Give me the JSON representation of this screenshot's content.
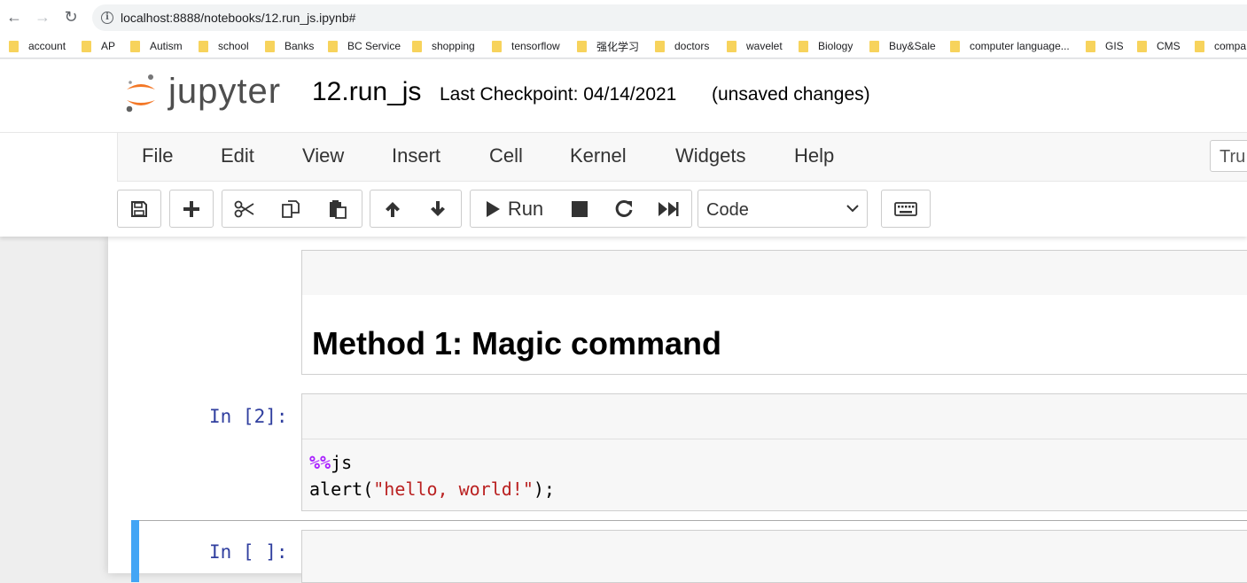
{
  "browser": {
    "url": "localhost:8888/notebooks/12.run_js.ipynb#",
    "back_glyph": "←",
    "forward_glyph": "→",
    "reload_glyph": "↻",
    "info_glyph": "i",
    "bookmarks": [
      "account",
      "AP",
      "Autism",
      "school",
      "Banks",
      "BC Service",
      "shopping",
      "tensorflow",
      "强化学习",
      "doctors",
      "wavelet",
      "Biology",
      "Buy&Sale",
      "computer language...",
      "GIS",
      "CMS",
      "compa"
    ]
  },
  "jupyter": {
    "logo_text": "jupyter",
    "notebook_name": "12.run_js",
    "checkpoint": "Last Checkpoint: 04/14/2021",
    "autosave_status": "(unsaved changes)",
    "menu": [
      "File",
      "Edit",
      "View",
      "Insert",
      "Cell",
      "Kernel",
      "Widgets",
      "Help"
    ],
    "trusted_label": "Tru",
    "toolbar": {
      "run_label": "Run",
      "cell_type": "Code"
    }
  },
  "cells": {
    "markdown_heading": "Method 1: Magic command",
    "code_cell_1": {
      "prompt": "In [2]:",
      "magic": "%%",
      "magic_rest": "js",
      "line2_fn": "alert(",
      "line2_str": "\"hello, world!\"",
      "line2_end": ");"
    },
    "code_cell_2": {
      "prompt": "In [ ]:"
    }
  },
  "colors": {
    "prompt": "#303f9f",
    "selected_bar": "#42a5f5",
    "magic_keyword": "#aa22ff",
    "string": "#ba2121",
    "logo_orange": "#f37726"
  }
}
